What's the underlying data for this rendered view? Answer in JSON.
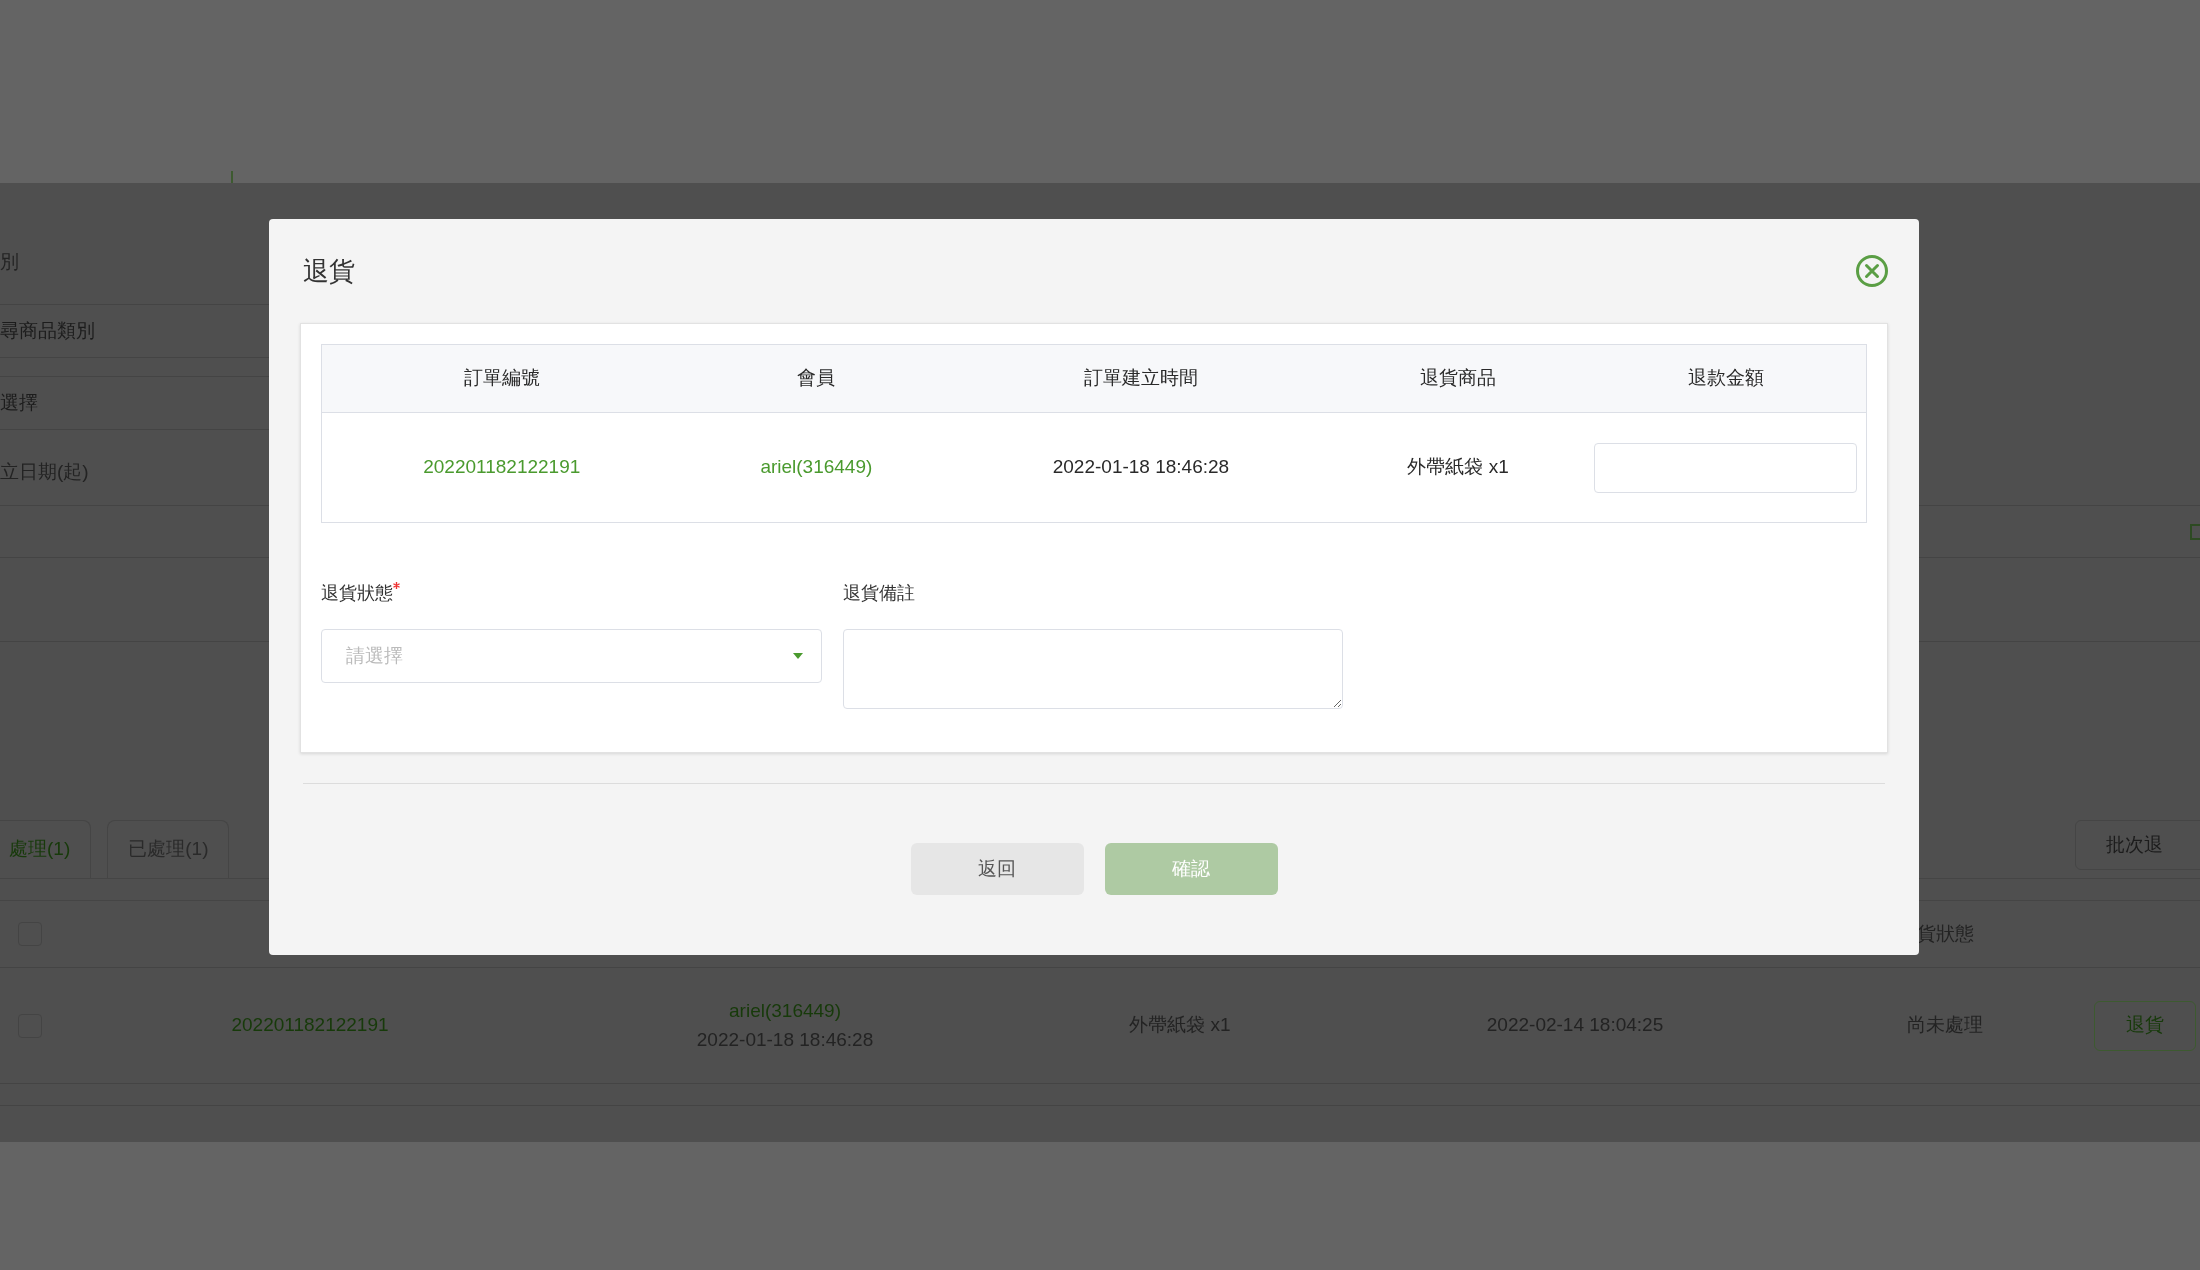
{
  "background": {
    "filters": [
      {
        "kind": "label",
        "text": "別"
      },
      {
        "kind": "field",
        "placeholder": "尋商品類別"
      },
      {
        "kind": "field",
        "placeholder": "選擇"
      },
      {
        "kind": "label",
        "text": "立日期(起)"
      },
      {
        "kind": "date"
      }
    ],
    "tabs": [
      {
        "label": "處理(1)",
        "selected": true
      },
      {
        "label": "已處理(1)",
        "selected": false
      }
    ],
    "batch_button": "批次退",
    "table": {
      "header_checked": false,
      "columns": [
        {
          "label": "貨狀態"
        }
      ],
      "rows": [
        {
          "checked": false,
          "order_no": "202201182122191",
          "member": "ariel(316449)",
          "created": "2022-01-18 18:46:28",
          "items": "外帶紙袋 x1",
          "return_time": "2022-02-14 18:04:25",
          "status": "尚未處理",
          "action": "退貨"
        }
      ]
    }
  },
  "dialog": {
    "title": "退貨",
    "table": {
      "columns": [
        "訂單編號",
        "會員",
        "訂單建立時間",
        "退貨商品",
        "退款金額"
      ],
      "rows": [
        {
          "order_no": "202201182122191",
          "member": "ariel(316449)",
          "created": "2022-01-18 18:46:28",
          "items": "外帶紙袋 x1"
        }
      ]
    },
    "form": {
      "status": {
        "label": "退貨狀態",
        "required": true,
        "placeholder": "請選擇"
      },
      "note": {
        "label": "退貨備註"
      }
    },
    "buttons": [
      {
        "kind": "back",
        "label": "返回",
        "disabled": false
      },
      {
        "kind": "confirm",
        "label": "確認",
        "disabled": true
      }
    ]
  }
}
